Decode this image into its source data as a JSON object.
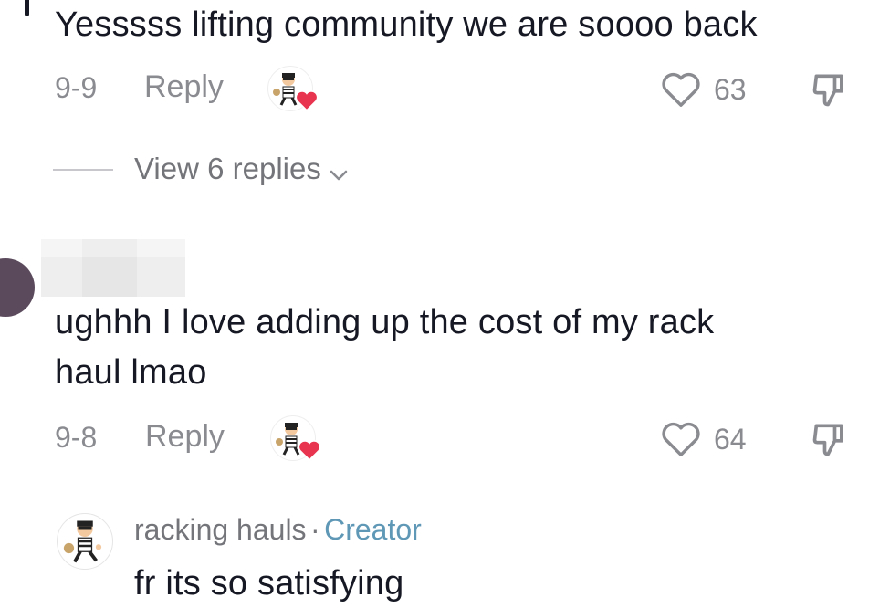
{
  "comments": [
    {
      "text": "Yesssss lifting community we are soooo back",
      "date": "9-9",
      "reply_label": "Reply",
      "like_count": "63",
      "view_replies_label": "View 6 replies"
    },
    {
      "text_line1": "ughhh I love adding up the cost of my rack",
      "text_line2": "haul lmao",
      "date": "9-8",
      "reply_label": "Reply",
      "like_count": "64"
    }
  ],
  "creator_reply": {
    "author": "racking hauls",
    "separator": "·",
    "badge": "Creator",
    "text": "fr its so satisfying"
  },
  "colors": {
    "heart_red": "#e8344f",
    "muted_text": "#8a8b91",
    "creator_blue": "#5f98b6"
  },
  "icons": [
    "heart-outline-icon",
    "dislike-icon",
    "chevron-down-icon",
    "creator-liked-heart-icon"
  ]
}
